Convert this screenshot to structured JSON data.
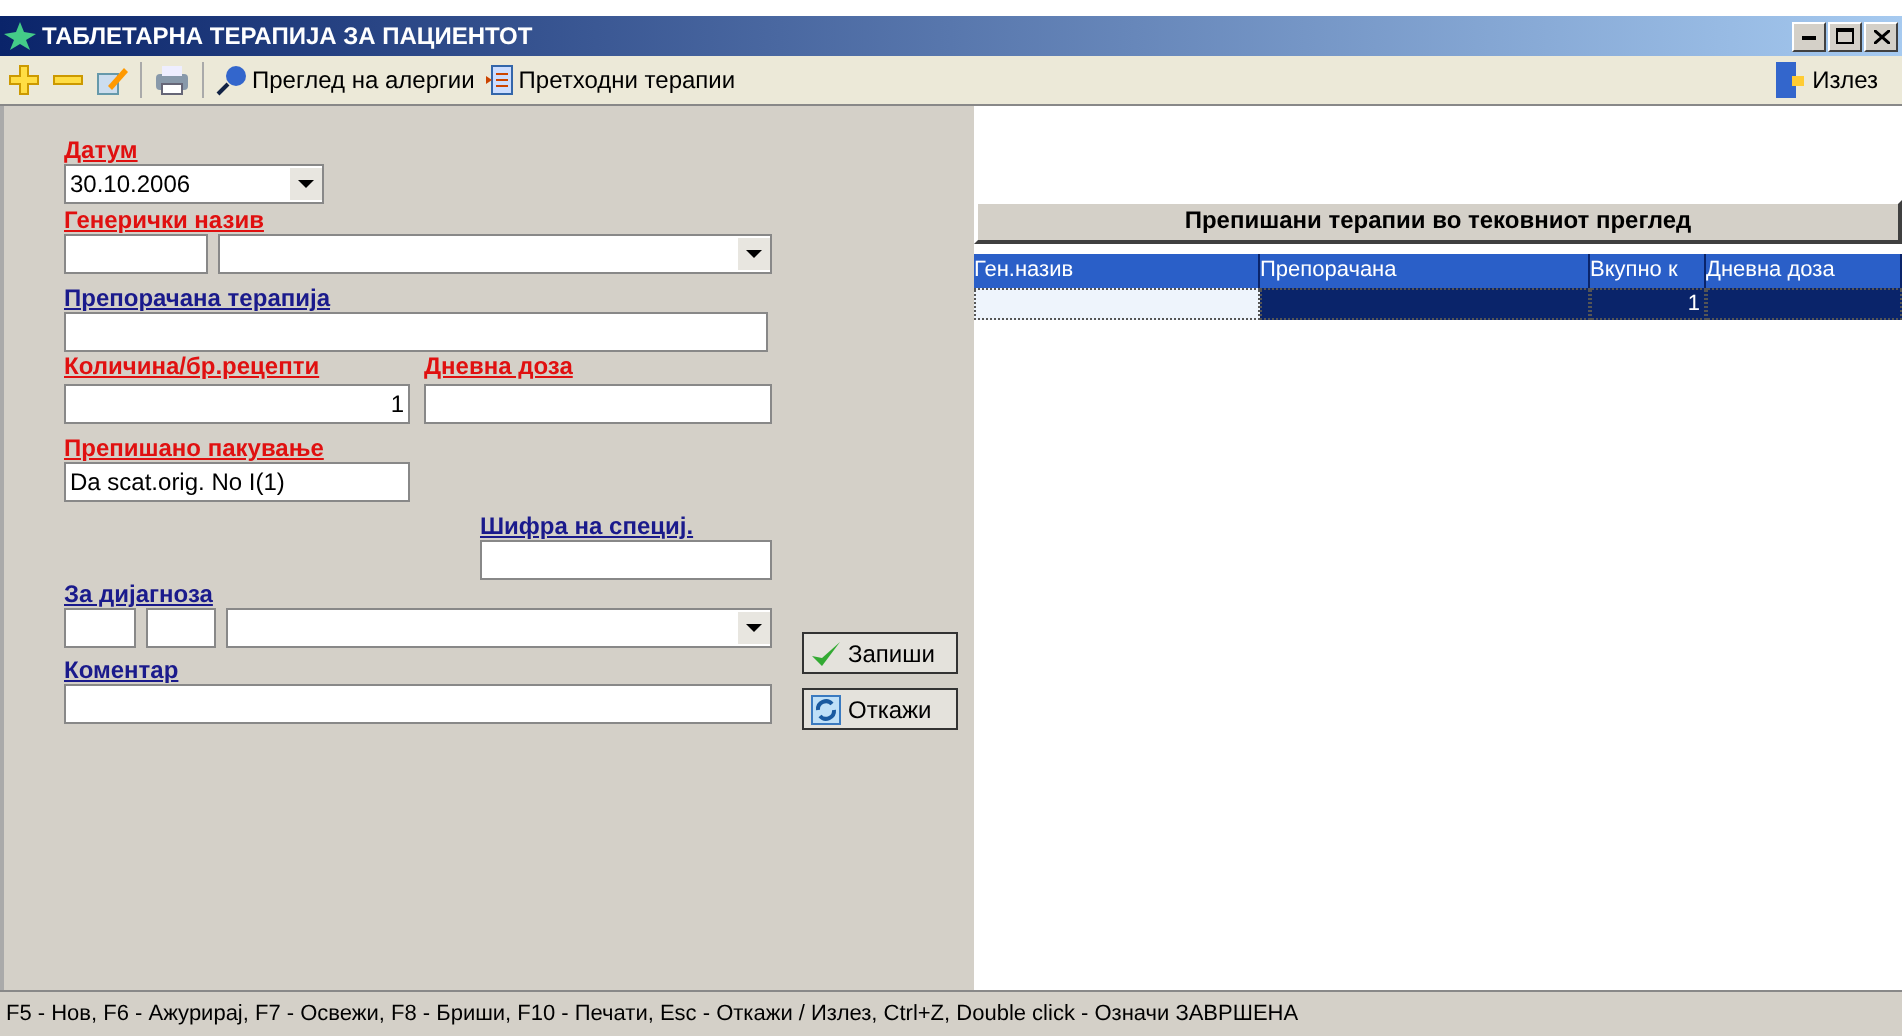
{
  "window": {
    "title": "ТАБЛЕТАРНА ТЕРАПИЈА ЗА ПАЦИЕНТОТ"
  },
  "toolbar": {
    "allergies": "Преглед на алергии",
    "previous": "Претходни терапии",
    "exit": "Излез"
  },
  "form": {
    "date": {
      "label": "Датум",
      "required": true,
      "value": "30.10.2006"
    },
    "generic_name": {
      "label": "Генерички назив",
      "required": true
    },
    "recommended": {
      "label": "Препорачана терапија",
      "required": false
    },
    "quantity": {
      "label": "Количина/бр.рецепти",
      "required": true,
      "value": "1"
    },
    "daily_dose": {
      "label": "Дневна доза",
      "required": true
    },
    "package": {
      "label": "Препишано пакување",
      "required": true,
      "value": "Da scat.orig. No I(1)"
    },
    "specialist_code": {
      "label": "Шифра на специј.",
      "required": false
    },
    "diagnosis": {
      "label": "За дијагноза",
      "required": false
    },
    "comment": {
      "label": "Коментар",
      "required": false
    }
  },
  "buttons": [
    {
      "kind": "save",
      "label": "Запиши"
    },
    {
      "kind": "cancel",
      "label": "Откажи"
    }
  ],
  "table": {
    "title": "Препишани терапии во тековниот преглед",
    "columns": [
      "Ген.назив",
      "Препорачана",
      "Вкупно к",
      "Дневна доза"
    ],
    "rows": [
      {
        "selected": true,
        "total": "1"
      }
    ]
  },
  "status_bar": "F5 - Нов, F6 - Ажурирај, F7 - Освежи, F8 - Бриши, F10 - Печати, Esc - Откажи / Излез, Ctrl+Z, Double click - Означи ЗАВРШЕНА"
}
